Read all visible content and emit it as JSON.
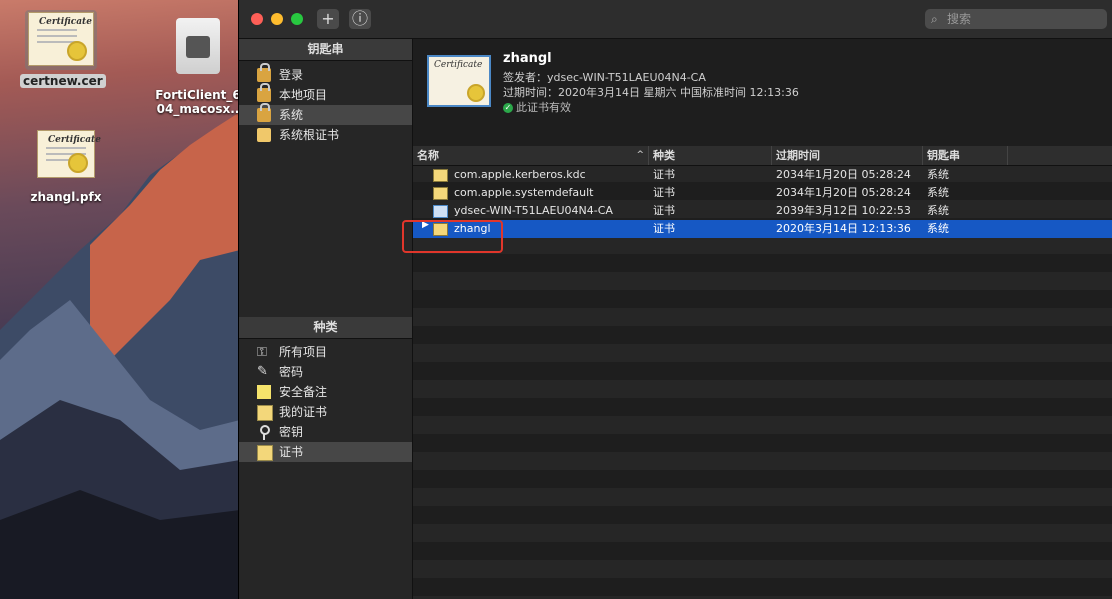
{
  "desktop": {
    "icons": [
      {
        "label": "certnew.cer",
        "cert_script": "Certificate"
      },
      {
        "label_line1": "FortiClient_6",
        "label_line2": "04_macosx.."
      },
      {
        "label": "zhangl.pfx",
        "cert_script": "Certificate"
      }
    ]
  },
  "toolbar": {
    "add_label": "+",
    "info_label": "ⓘ",
    "search_placeholder": "搜索",
    "search_icon": "magnifier-icon"
  },
  "sidebar": {
    "keychains_header": "钥匙串",
    "keychains": [
      {
        "label": "登录",
        "icon": "lock-open-icon"
      },
      {
        "label": "本地项目",
        "icon": "lock-icon"
      },
      {
        "label": "系统",
        "icon": "lock-icon",
        "selected": true
      },
      {
        "label": "系统根证书",
        "icon": "folder-icon"
      }
    ],
    "category_header": "种类",
    "categories": [
      {
        "label": "所有项目",
        "icon": "all-items-icon"
      },
      {
        "label": "密码",
        "icon": "pen-icon"
      },
      {
        "label": "安全备注",
        "icon": "note-icon"
      },
      {
        "label": "我的证书",
        "icon": "certificate-icon"
      },
      {
        "label": "密钥",
        "icon": "key-icon"
      },
      {
        "label": "证书",
        "icon": "certificate-icon",
        "selected": true
      }
    ]
  },
  "detail": {
    "cert_script": "Certificate",
    "name": "zhangl",
    "issuer": "签发者：ydsec-WIN-T51LAEU04N4-CA",
    "expires": "过期时间：2020年3月14日 星期六 中国标准时间 12:13:36",
    "status": "此证书有效"
  },
  "table": {
    "headers": [
      "名称",
      "种类",
      "过期时间",
      "钥匙串"
    ],
    "sort_indicator": "^",
    "rows": [
      {
        "name": "com.apple.kerberos.kdc",
        "kind": "证书",
        "expires": "2034年1月20日 05:28:24",
        "keychain": "系统"
      },
      {
        "name": "com.apple.systemdefault",
        "kind": "证书",
        "expires": "2034年1月20日 05:28:24",
        "keychain": "系统"
      },
      {
        "name": "ydsec-WIN-T51LAEU04N4-CA",
        "kind": "证书",
        "expires": "2039年3月12日 10:22:53",
        "keychain": "系统"
      },
      {
        "name": "zhangl",
        "kind": "证书",
        "expires": "2020年3月14日 12:13:36",
        "keychain": "系统",
        "selected": true,
        "disclosure": "▶"
      }
    ]
  },
  "colors": {
    "selection": "#1658c4",
    "highlight_border": "#e0362b"
  }
}
